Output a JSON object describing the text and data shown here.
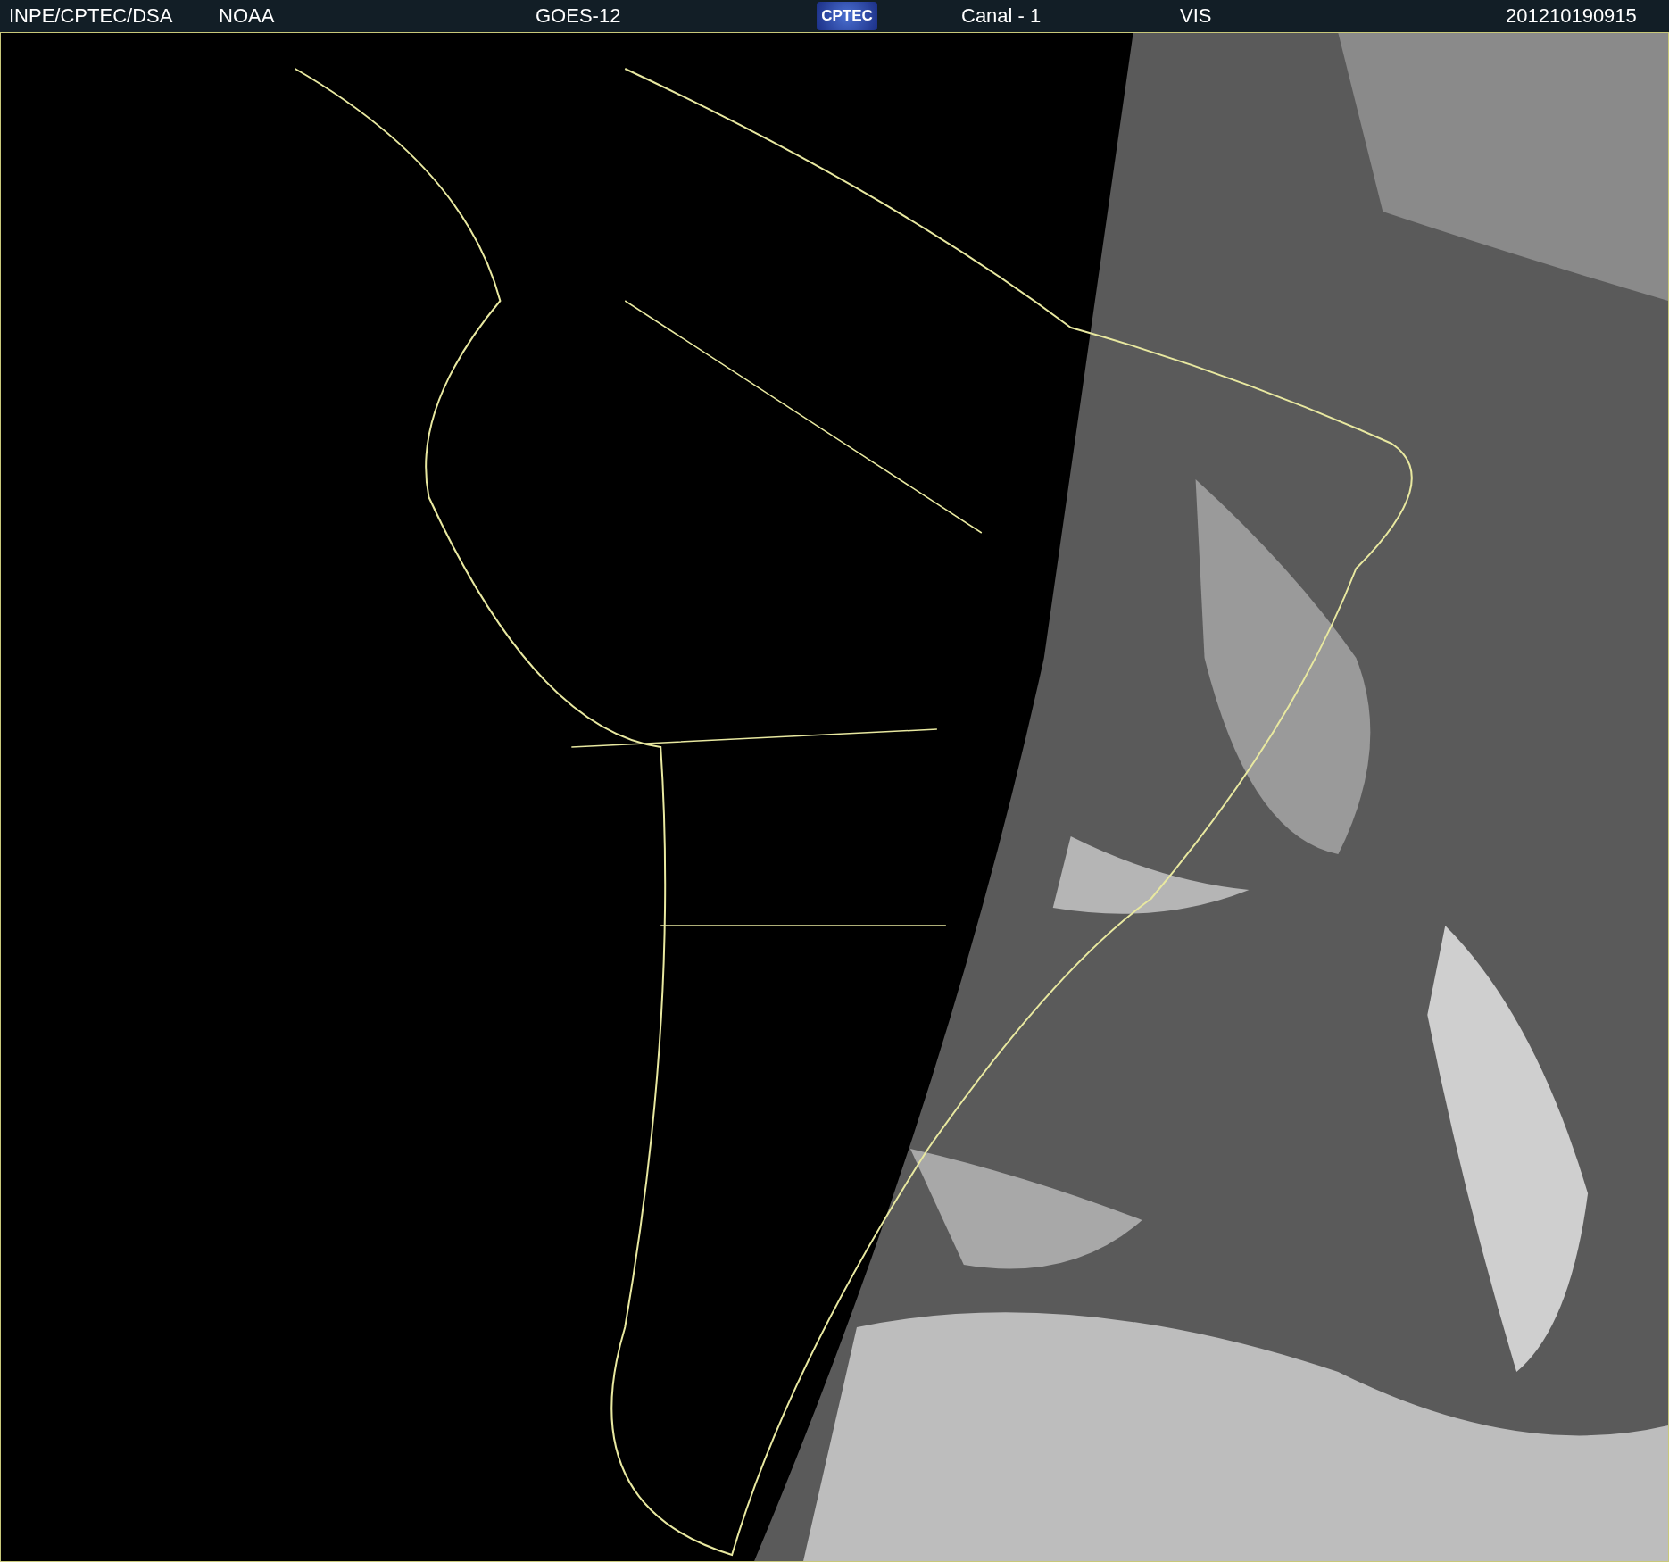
{
  "header": {
    "source": "INPE/CPTEC/DSA",
    "agency": "NOAA",
    "satellite": "GOES-12",
    "logo": "CPTEC",
    "channel": "Canal - 1",
    "band": "VIS",
    "timestamp": "201210190915"
  }
}
